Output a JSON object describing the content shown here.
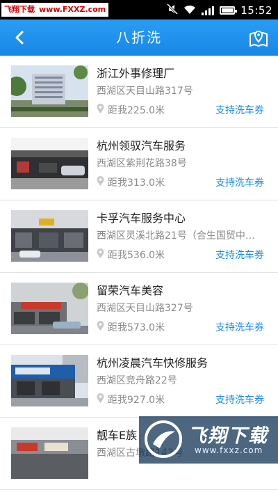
{
  "status_bar": {
    "watermark_site": "飞翔下载",
    "watermark_url": "www.FXXZ.com",
    "time": "15:52",
    "icons": [
      "mute-icon",
      "wifi-icon",
      "signal-icon",
      "battery-icon"
    ]
  },
  "header": {
    "title": "八折洗",
    "back_icon": "back-arrow-icon",
    "map_icon": "map-location-icon",
    "color": "#1e90ef"
  },
  "shops": [
    {
      "name": "浙江外事修理厂",
      "address": "西湖区天目山路317号",
      "distance": "距我225.0米",
      "tag": "支持洗车券"
    },
    {
      "name": "杭州领驭汽车服务",
      "address": "西湖区紫荆花路38号",
      "distance": "距我313.0米",
      "tag": "支持洗车券"
    },
    {
      "name": "卡孚汽车服务中心",
      "address": "西湖区灵溪北路21号（合生国贸中…",
      "distance": "距我536.0米",
      "tag": "支持洗车券"
    },
    {
      "name": "留荣汽车美容",
      "address": "西湖区天目山路327号",
      "distance": "距我573.0米",
      "tag": "支持洗车券"
    },
    {
      "name": "杭州凌晨汽车快修服务",
      "address": "西湖区竞舟路22号",
      "distance": "距我927.0米",
      "tag": "支持洗车券"
    },
    {
      "name": "靓车E族",
      "address": "西湖区古墩路143号",
      "distance": "",
      "tag": ""
    }
  ],
  "watermark": {
    "name": "飞翔下载",
    "url": "www.fxxz.com"
  },
  "colors": {
    "accent": "#1a8be6",
    "text_secondary": "#8a8a8a"
  }
}
